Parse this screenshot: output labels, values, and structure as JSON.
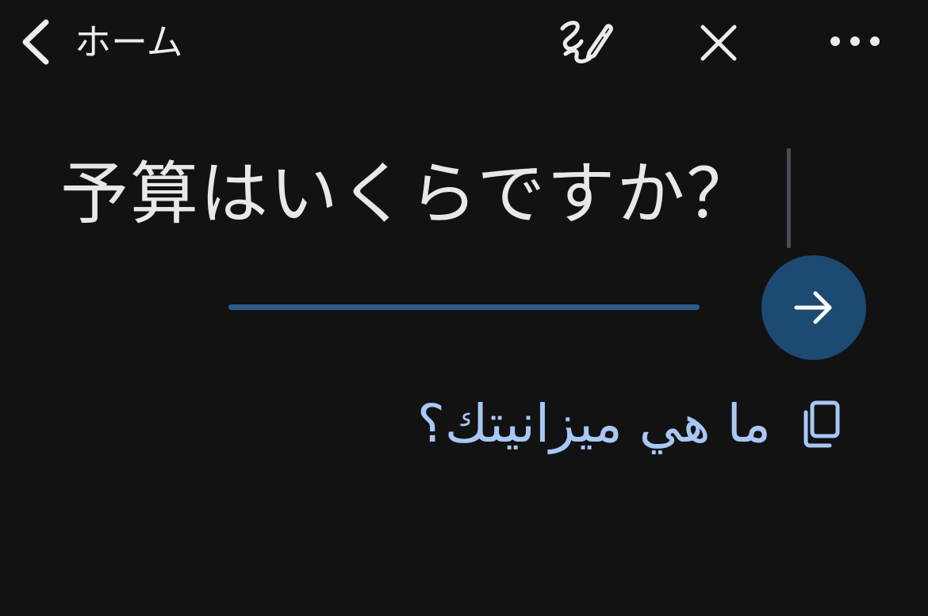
{
  "header": {
    "back_label": "ホーム",
    "icons": {
      "back": "chevron-left-icon",
      "handwriting": "handwriting-pen-icon",
      "close": "close-icon",
      "more": "more-horizontal-icon"
    }
  },
  "input": {
    "text": "予算はいくらですか？"
  },
  "submit": {
    "icon": "arrow-right-icon"
  },
  "translation": {
    "text": "ما هي ميزانيتك؟",
    "copy_icon": "copy-icon"
  },
  "colors": {
    "background": "#121212",
    "text": "#e8e8e8",
    "accent_button": "#1d4a73",
    "underline": "#2e5c8a",
    "translation": "#a8c7f5"
  }
}
